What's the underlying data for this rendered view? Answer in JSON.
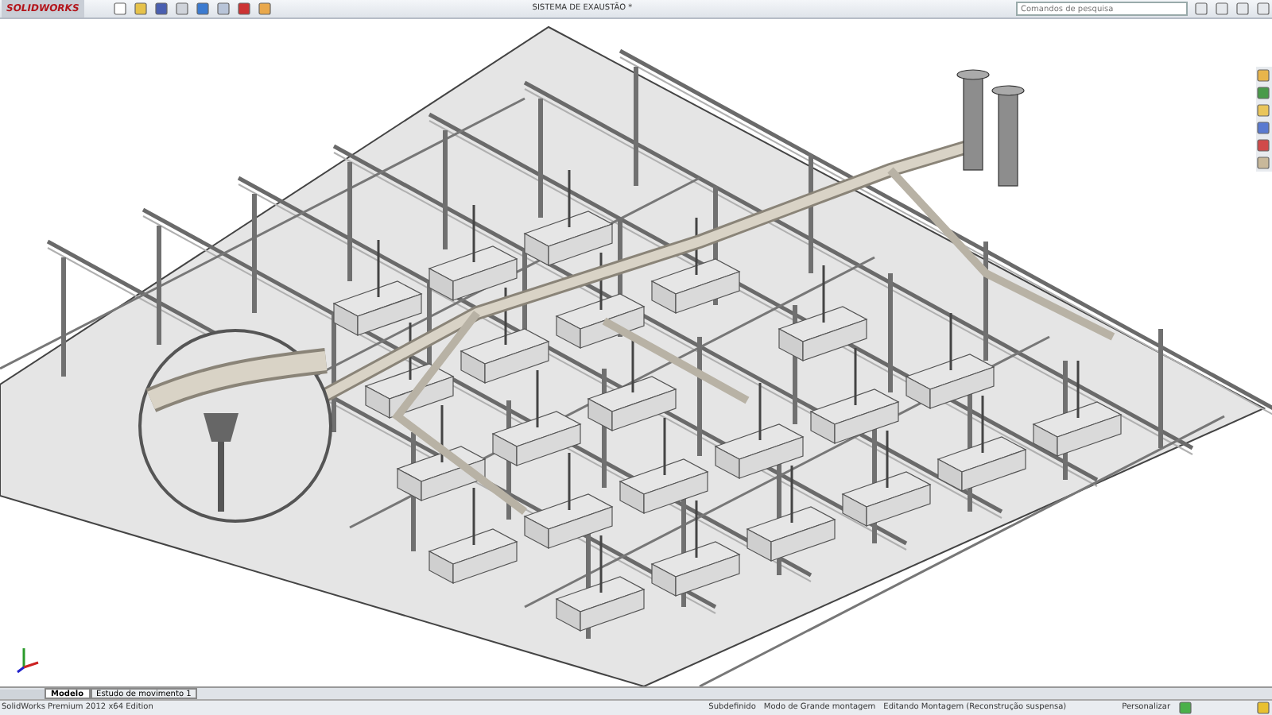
{
  "title_bar": {
    "logo": "SOLIDWORKS",
    "title": "SISTEMA DE EXAUSTÃO *",
    "search": {
      "placeholder": "Comandos de pesquisa"
    }
  },
  "tabs": [
    {
      "label": "Modelo",
      "selected": true
    },
    {
      "label": "Estudo de movimento 1",
      "selected": false
    }
  ],
  "status_bar": {
    "product": "SolidWorks Premium 2012 x64 Edition",
    "items": [
      "Subdefinido",
      "Modo de Grande montagem",
      "Editando Montagem (Reconstrução suspensa)"
    ],
    "customize": "Personalizar"
  }
}
